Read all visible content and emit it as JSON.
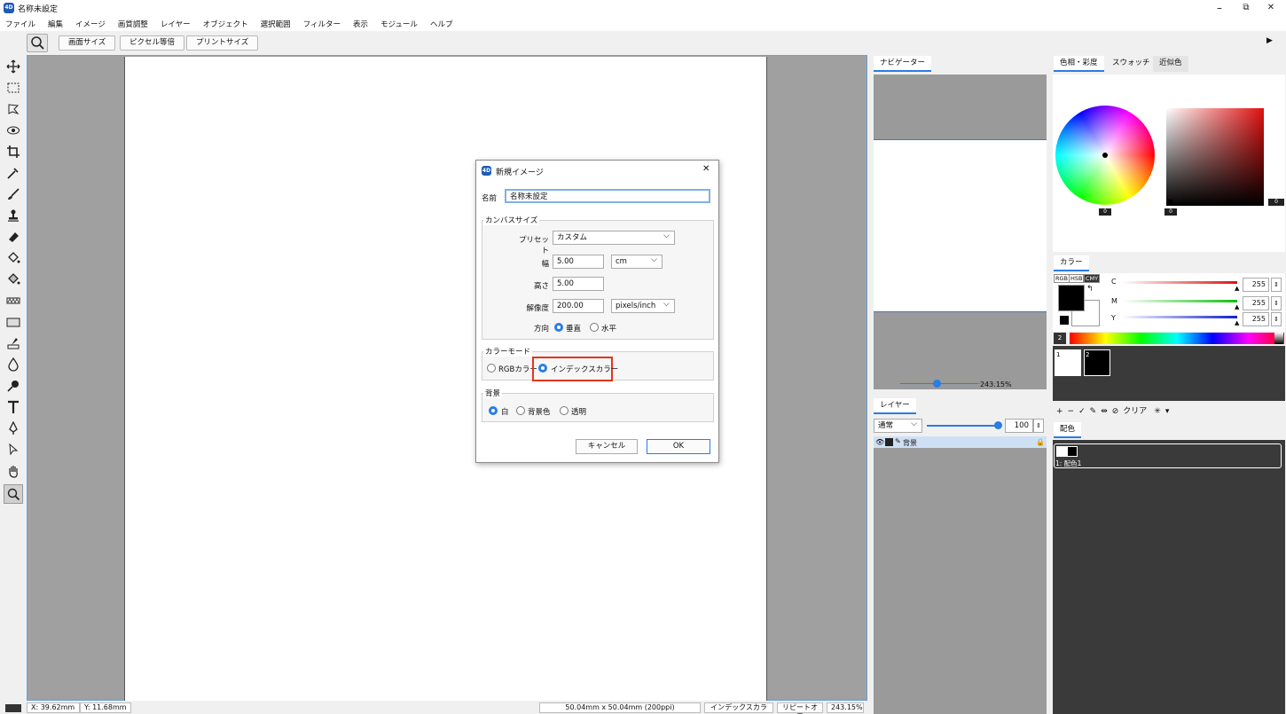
{
  "app": {
    "icon_text": "4D",
    "title": "名称未設定"
  },
  "window_buttons": {
    "minimize": "–",
    "restore": "⧉",
    "close": "✕"
  },
  "menu": [
    "ファイル",
    "編集",
    "イメージ",
    "画質調整",
    "レイヤー",
    "オブジェクト",
    "選択範囲",
    "フィルター",
    "表示",
    "モジュール",
    "ヘルプ"
  ],
  "toolbar": {
    "zoom_icon": "magnifier-icon",
    "buttons": [
      "画面サイズ",
      "ピクセル等倍",
      "プリントサイズ"
    ],
    "expand_icon": "▶"
  },
  "tools": [
    "move-icon",
    "rect-select-icon",
    "lasso-icon",
    "eye-icon",
    "crop-icon",
    "eyedropper-icon",
    "brush-icon",
    "stamp-icon",
    "eraser-icon",
    "fill-icon",
    "fill-pattern-icon",
    "gradient-icon",
    "rectangle-icon",
    "pen-fill-icon",
    "drop-icon",
    "dodge-icon",
    "text-icon",
    "pen-icon",
    "path-select-icon",
    "hand-icon",
    "zoom-icon"
  ],
  "status": {
    "x": "X:  39.62mm",
    "y": "Y:  11.68mm",
    "size": "50.04mm x 50.04mm (200ppi)",
    "mode": "インデックスカラー",
    "repeat": "リピートオフ",
    "zoom": "243.15%"
  },
  "dialog": {
    "title": "新規イメージ",
    "close": "✕",
    "name_label": "名前",
    "name_value": "名称未設定",
    "canvas_size_label": "カンバスサイズ",
    "preset_label": "プリセット",
    "preset_value": "カスタム",
    "width_label": "幅",
    "width_value": "5.00",
    "unit_value": "cm",
    "height_label": "高さ",
    "height_value": "5.00",
    "resolution_label": "解像度",
    "resolution_value": "200.00",
    "resolution_unit": "pixels/inch",
    "orientation_label": "方向",
    "orientation_vertical": "垂直",
    "orientation_horizontal": "水平",
    "color_mode_label": "カラーモード",
    "rgb_label": "RGBカラー",
    "index_label": "インデックスカラー",
    "background_label": "背景",
    "bg_white": "白",
    "bg_color": "背景色",
    "bg_transparent": "透明",
    "cancel": "キャンセル",
    "ok": "OK",
    "highlight_color": "#e8321e"
  },
  "navigator": {
    "tab": "ナビゲーター",
    "zoom": "243.15%"
  },
  "layers": {
    "tab": "レイヤー",
    "blend": "通常",
    "opacity": "100",
    "layer_name": "背景"
  },
  "color_tabs": [
    "色相・彩度",
    "スウォッチ",
    "近似色"
  ],
  "hue": {
    "value_left": "0",
    "value_mid": "0",
    "value_right": "0"
  },
  "color_panel": {
    "tab": "カラー",
    "modes": [
      "RGB",
      "HSB",
      "CMY"
    ],
    "labels": [
      "C",
      "M",
      "Y"
    ],
    "values": [
      "255",
      "255",
      "255"
    ],
    "swatch_count": "2"
  },
  "swatches": {
    "s1": "1",
    "s2": "2"
  },
  "palette_toolbar": [
    "+",
    "−",
    "✓",
    "✎",
    "⇹",
    "⊘",
    "クリア",
    "✳",
    "▾"
  ],
  "scheme": {
    "tab": "配色",
    "item": "1: 配色1"
  }
}
